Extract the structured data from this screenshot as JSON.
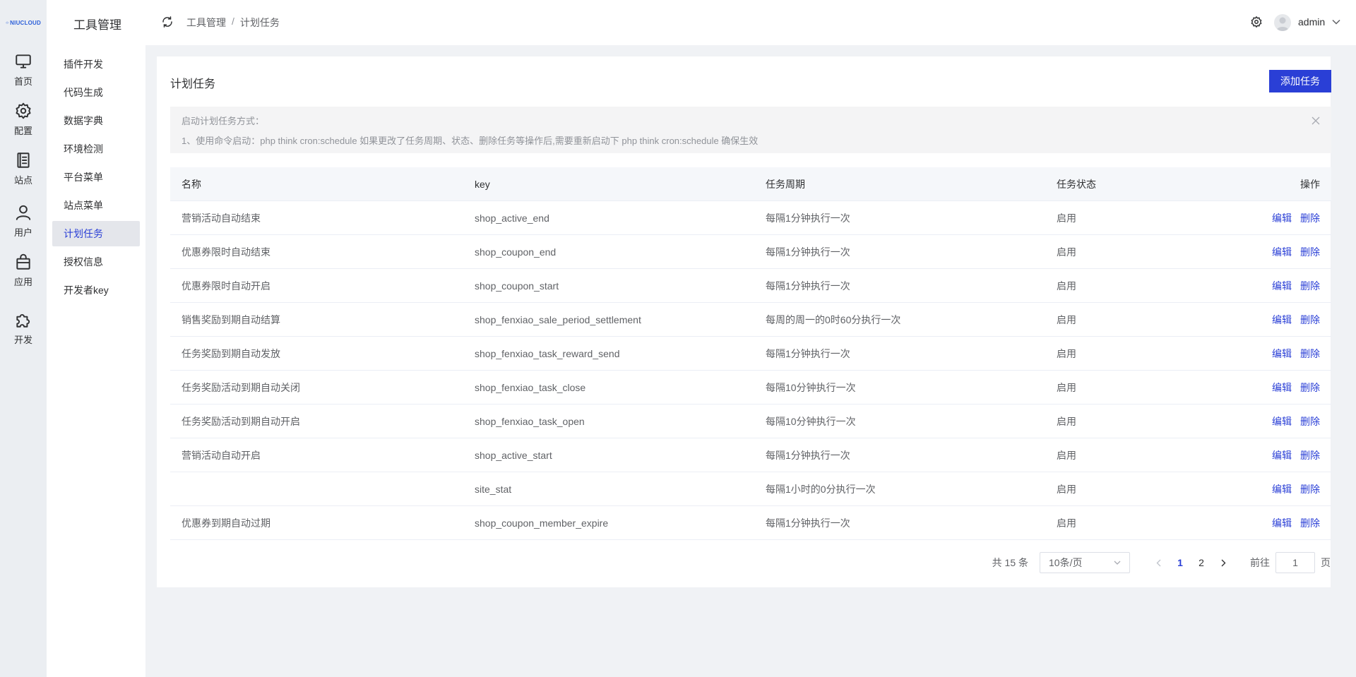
{
  "logo": {
    "text": "NIUCLOUD"
  },
  "rail": [
    {
      "label": "首页",
      "icon": "monitor-icon"
    },
    {
      "label": "配置",
      "icon": "gear-icon"
    },
    {
      "label": "站点",
      "icon": "document-icon"
    },
    {
      "label": "用户",
      "icon": "user-icon"
    },
    {
      "label": "应用",
      "icon": "bag-icon"
    },
    {
      "label": "开发",
      "icon": "puzzle-icon"
    }
  ],
  "submenu": {
    "title": "工具管理",
    "items": [
      "插件开发",
      "代码生成",
      "数据字典",
      "环境检测",
      "平台菜单",
      "站点菜单",
      "计划任务",
      "授权信息",
      "开发者key"
    ],
    "active_index": 6
  },
  "header": {
    "breadcrumb": [
      "工具管理",
      "计划任务"
    ],
    "separator": "/",
    "user": "admin"
  },
  "page": {
    "title": "计划任务",
    "add_button": "添加任务",
    "alert": {
      "title": "启动计划任务方式：",
      "description": "1、使用命令启动：php think cron:schedule 如果更改了任务周期、状态、删除任务等操作后,需要重新启动下 php think cron:schedule 确保生效"
    },
    "table": {
      "columns": [
        "名称",
        "key",
        "任务周期",
        "任务状态",
        "操作"
      ],
      "rows": [
        {
          "name": "营销活动自动结束",
          "key": "shop_active_end",
          "cycle": "每隔1分钟执行一次",
          "status": "启用"
        },
        {
          "name": "优惠券限时自动结束",
          "key": "shop_coupon_end",
          "cycle": "每隔1分钟执行一次",
          "status": "启用"
        },
        {
          "name": "优惠券限时自动开启",
          "key": "shop_coupon_start",
          "cycle": "每隔1分钟执行一次",
          "status": "启用"
        },
        {
          "name": "销售奖励到期自动结算",
          "key": "shop_fenxiao_sale_period_settlement",
          "cycle": "每周的周一的0时60分执行一次",
          "status": "启用"
        },
        {
          "name": "任务奖励到期自动发放",
          "key": "shop_fenxiao_task_reward_send",
          "cycle": "每隔1分钟执行一次",
          "status": "启用"
        },
        {
          "name": "任务奖励活动到期自动关闭",
          "key": "shop_fenxiao_task_close",
          "cycle": "每隔10分钟执行一次",
          "status": "启用"
        },
        {
          "name": "任务奖励活动到期自动开启",
          "key": "shop_fenxiao_task_open",
          "cycle": "每隔10分钟执行一次",
          "status": "启用"
        },
        {
          "name": "营销活动自动开启",
          "key": "shop_active_start",
          "cycle": "每隔1分钟执行一次",
          "status": "启用"
        },
        {
          "name": "",
          "key": "site_stat",
          "cycle": "每隔1小时的0分执行一次",
          "status": "启用"
        },
        {
          "name": "优惠券到期自动过期",
          "key": "shop_coupon_member_expire",
          "cycle": "每隔1分钟执行一次",
          "status": "启用"
        }
      ],
      "edit_label": "编辑",
      "delete_label": "删除"
    },
    "pagination": {
      "total": "共 15 条",
      "page_size": "10条/页",
      "pages": [
        "1",
        "2"
      ],
      "current": "1",
      "goto_prefix": "前往",
      "goto_value": "1",
      "goto_suffix": "页"
    }
  },
  "colors": {
    "primary": "#2a3fd6",
    "rail_bg": "#ebeef2",
    "page_bg": "#f0f2f5"
  }
}
